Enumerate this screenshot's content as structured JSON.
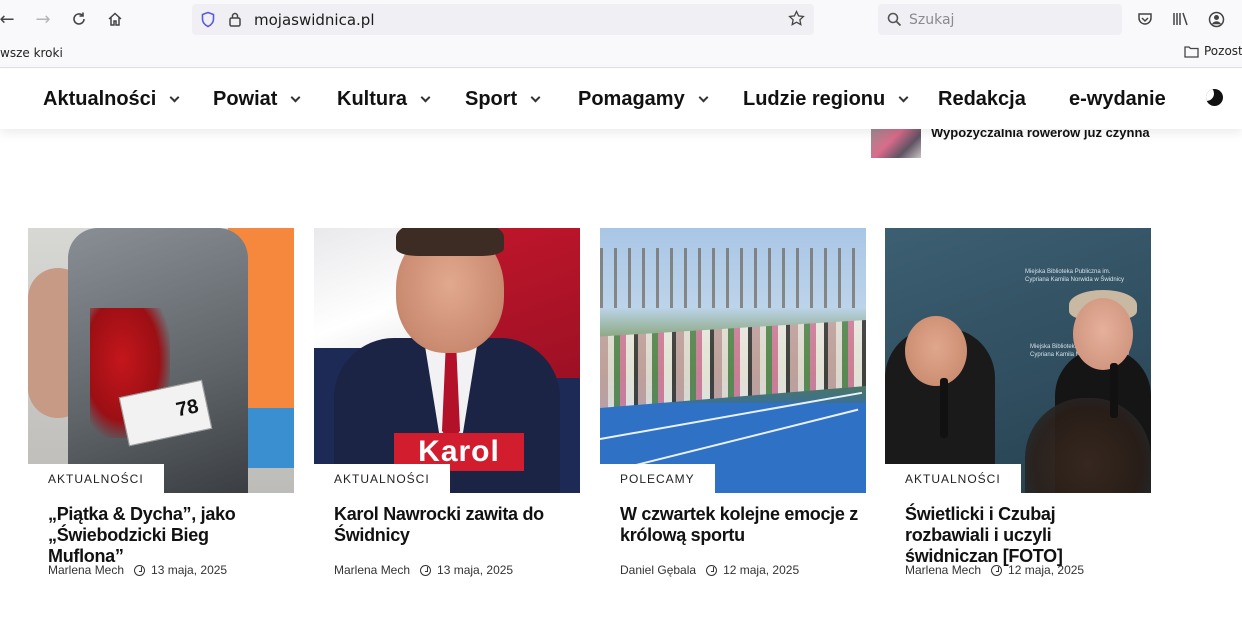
{
  "browser": {
    "url": "mojaswidnica.pl",
    "search_placeholder": "Szukaj",
    "bookmark_left": "wsze kroki",
    "bookmark_right": "Pozosta"
  },
  "site_nav": {
    "items": [
      {
        "label": "Aktualności",
        "has_dropdown": true
      },
      {
        "label": "Powiat",
        "has_dropdown": true
      },
      {
        "label": "Kultura",
        "has_dropdown": true
      },
      {
        "label": "Sport",
        "has_dropdown": true
      },
      {
        "label": "Pomagamy",
        "has_dropdown": true
      },
      {
        "label": "Ludzie regionu",
        "has_dropdown": true
      },
      {
        "label": "Redakcja",
        "has_dropdown": false
      },
      {
        "label": "e-wydanie",
        "has_dropdown": false
      }
    ],
    "dark_mode_icon": "moon-icon"
  },
  "teaser": {
    "title": "Wypożyczalnia rowerów już czynna"
  },
  "cards": [
    {
      "category": "AKTUALNOŚCI",
      "title": "„Piątka & Dycha”, jako „Świebodzicki Bieg Muflona”",
      "author": "Marlena Mech",
      "date": "13 maja, 2025",
      "image_text": "78"
    },
    {
      "category": "AKTUALNOŚCI",
      "title": "Karol Nawrocki zawita do Świdnicy",
      "author": "Marlena Mech",
      "date": "13 maja, 2025",
      "image_text": "Karol"
    },
    {
      "category": "POLECAMY",
      "title": "W czwartek kolejne emocje z królową sportu",
      "author": "Daniel Gębala",
      "date": "12 maja, 2025"
    },
    {
      "category": "AKTUALNOŚCI",
      "title": "Świetlicki i Czubaj rozbawiali i uczyli świdniczan [FOTO]",
      "author": "Marlena Mech",
      "date": "12 maja, 2025",
      "image_text": "Miejska Biblioteka Publiczna im. Cypriana Kamila Norwida w Świdnicy"
    }
  ]
}
